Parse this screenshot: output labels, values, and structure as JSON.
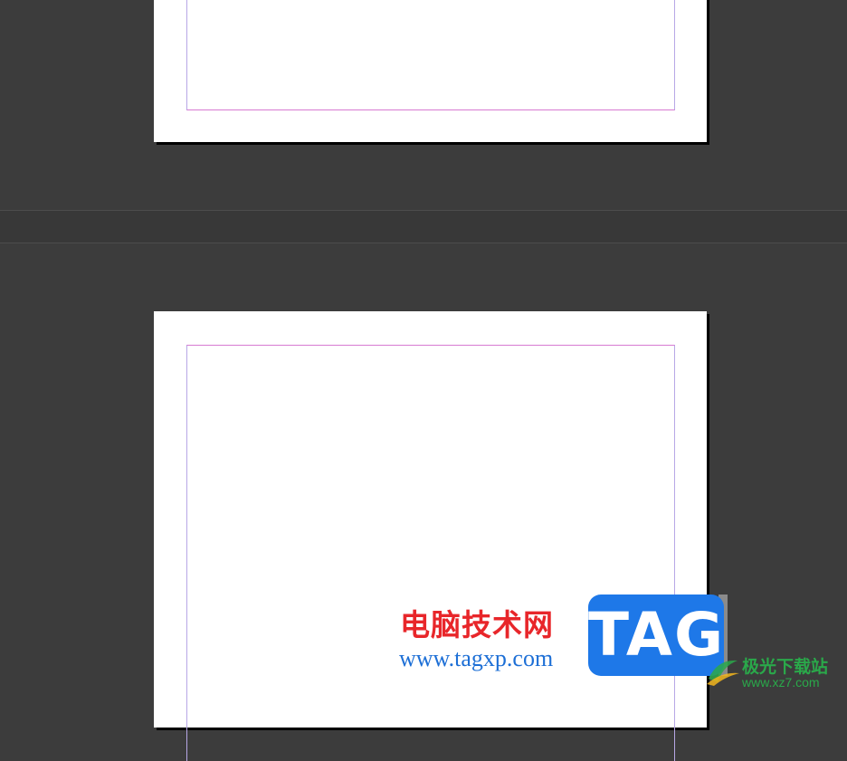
{
  "watermark": {
    "brand_cn": "电脑技术网",
    "brand_url": "www.tagxp.com",
    "tag_text": "TAG",
    "site_cn": "极光下载站",
    "site_url": "www.xz7.com"
  },
  "colors": {
    "pasteboard": "#3c3c3c",
    "page": "#ffffff",
    "margin_top_bottom": "#d77ad2",
    "margin_sides": "#b7a7e6",
    "tag_blue": "#1e78e8",
    "brand_red": "#e8262a",
    "site_green": "#2aa84a"
  }
}
